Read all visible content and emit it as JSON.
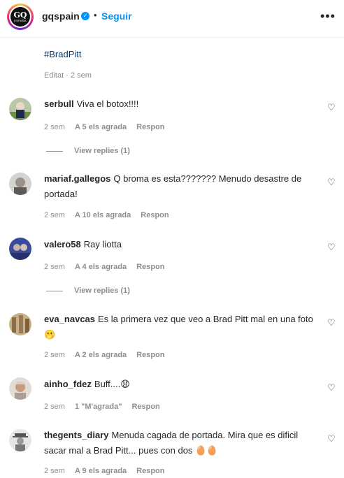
{
  "header": {
    "logo_text": "GQ",
    "logo_sub": "ESPAÑA",
    "username": "gqspain",
    "verified_icon": "verified-badge",
    "separator": "•",
    "follow_label": "Seguir",
    "more_icon": "more-options"
  },
  "caption": {
    "hashtag": "#BradPitt",
    "edited": "Editat · 2 sem"
  },
  "comments": [
    {
      "user": "serbull",
      "text": "Viva el botox!!!!",
      "time": "2 sem",
      "likes": "A 5 els agrada",
      "reply": "Respon",
      "view_replies": "View replies (1)"
    },
    {
      "user": "mariaf.gallegos",
      "text": "Q broma es esta??????? Menudo desastre de portada!",
      "time": "2 sem",
      "likes": "A 10 els agrada",
      "reply": "Respon"
    },
    {
      "user": "valero58",
      "text": "Ray liotta",
      "time": "2 sem",
      "likes": "A 4 els agrada",
      "reply": "Respon",
      "view_replies": "View replies (1)"
    },
    {
      "user": "eva_navcas",
      "text": "Es la primera vez que veo a Brad Pitt mal en una foto 🫢",
      "time": "2 sem",
      "likes": "A 2 els agrada",
      "reply": "Respon"
    },
    {
      "user": "ainho_fdez",
      "text": "Buff....😧",
      "time": "2 sem",
      "likes": "1 \"M'agrada\"",
      "reply": "Respon"
    },
    {
      "user": "thegents_diary",
      "text": "Menuda cagada de portada. Mira que es dificil sacar mal a Brad Pitt... pues con dos 🥚🥚",
      "time": "2 sem",
      "likes": "A 9 els agrada",
      "reply": "Respon"
    }
  ],
  "icons": {
    "like": "heart-outline"
  }
}
